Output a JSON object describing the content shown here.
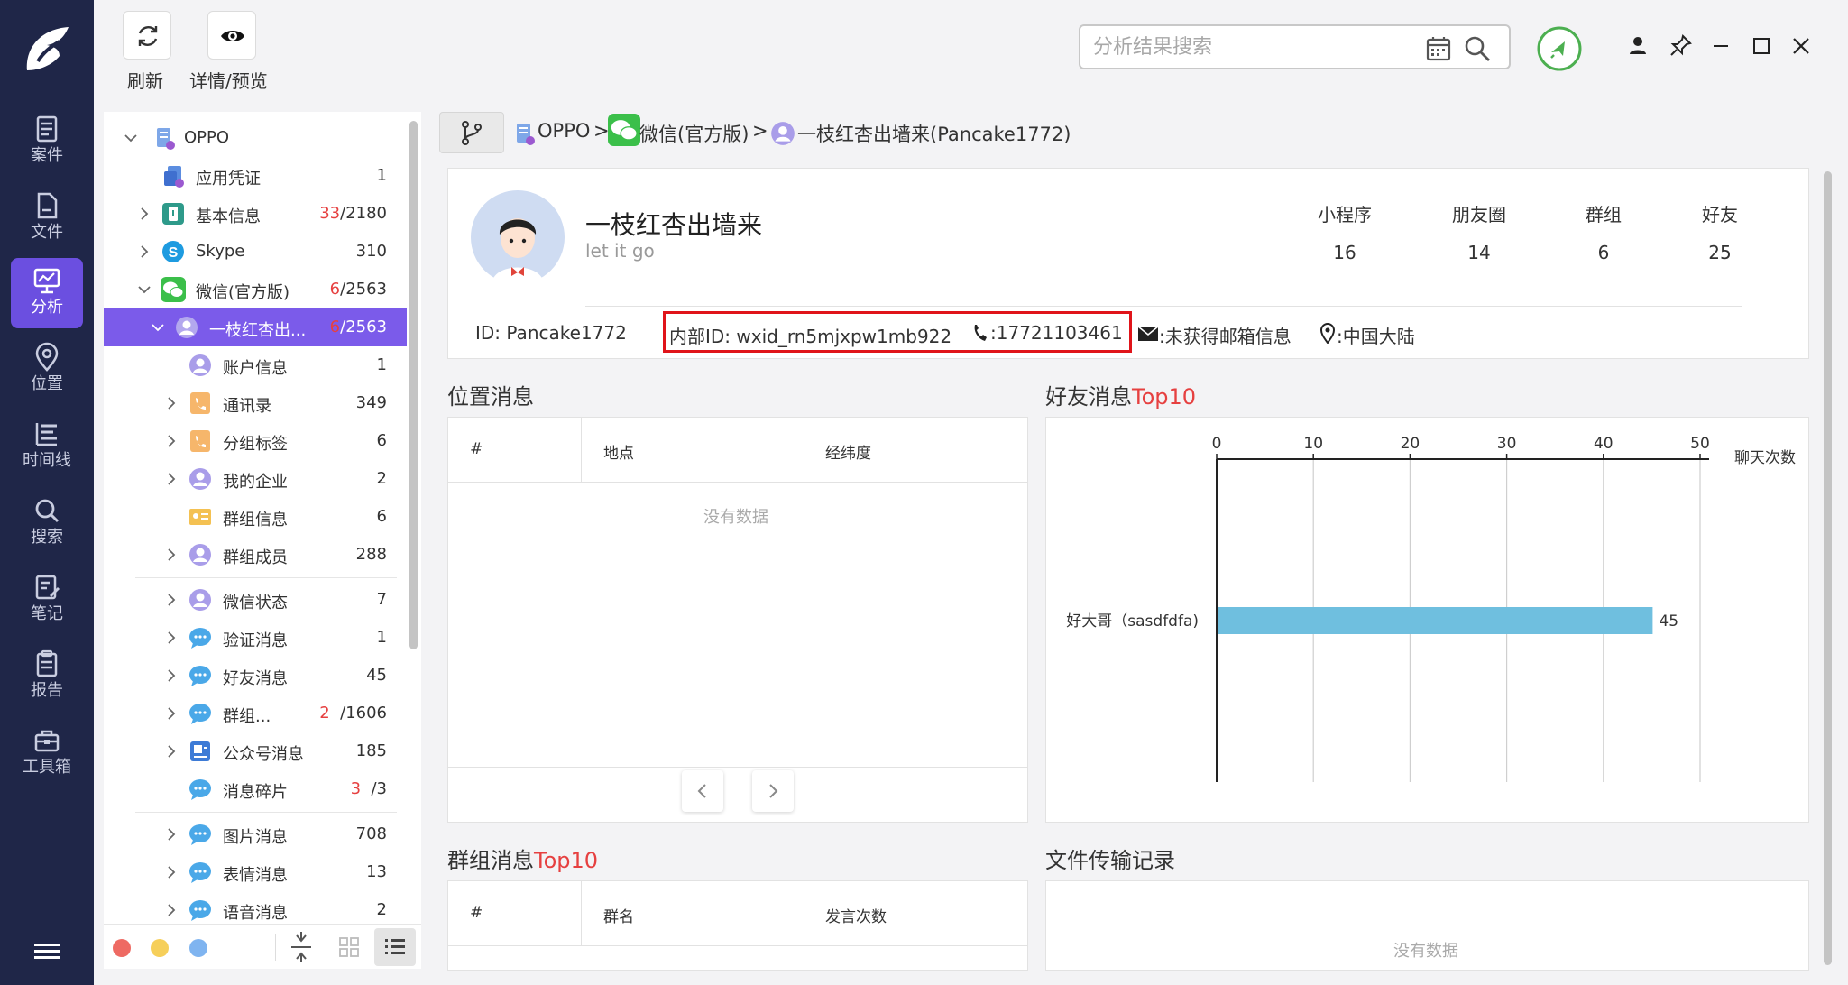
{
  "nav": {
    "items": [
      {
        "label": "案件",
        "icon": "case-icon"
      },
      {
        "label": "文件",
        "icon": "file-icon"
      },
      {
        "label": "分析",
        "icon": "analysis-icon"
      },
      {
        "label": "位置",
        "icon": "location-icon"
      },
      {
        "label": "时间线",
        "icon": "timeline-icon"
      },
      {
        "label": "搜索",
        "icon": "search-icon"
      },
      {
        "label": "笔记",
        "icon": "note-icon"
      },
      {
        "label": "报告",
        "icon": "report-icon"
      },
      {
        "label": "工具箱",
        "icon": "toolbox-icon"
      }
    ],
    "active_index": 2
  },
  "toolbar": {
    "refresh_label": "刷新",
    "preview_label": "详情/预览",
    "search_placeholder": "分析结果搜索"
  },
  "tree": {
    "rows": [
      {
        "label": "OPPO",
        "count": "",
        "count_red": ""
      },
      {
        "label": "应用凭证",
        "count": "1",
        "count_red": ""
      },
      {
        "label": "基本信息",
        "count": "/2180",
        "count_red": "33"
      },
      {
        "label": "Skype",
        "count": "310",
        "count_red": ""
      },
      {
        "label": "微信(官方版)",
        "count": "/2563",
        "count_red": "6"
      },
      {
        "label": "一枝红杏出...",
        "count": "/2563",
        "count_red": "6"
      },
      {
        "label": "账户信息",
        "count": "1",
        "count_red": ""
      },
      {
        "label": "通讯录",
        "count": "349",
        "count_red": ""
      },
      {
        "label": "分组标签",
        "count": "6",
        "count_red": ""
      },
      {
        "label": "我的企业",
        "count": "2",
        "count_red": ""
      },
      {
        "label": "群组信息",
        "count": "6",
        "count_red": ""
      },
      {
        "label": "群组成员",
        "count": "288",
        "count_red": ""
      },
      {
        "label": "微信状态",
        "count": "7",
        "count_red": ""
      },
      {
        "label": "验证消息",
        "count": "1",
        "count_red": ""
      },
      {
        "label": "好友消息",
        "count": "45",
        "count_red": ""
      },
      {
        "label": "群组...",
        "count": "/1606",
        "count_red": "2"
      },
      {
        "label": "公众号消息",
        "count": "185",
        "count_red": ""
      },
      {
        "label": "消息碎片",
        "count": "/3",
        "count_red": "3"
      },
      {
        "label": "图片消息",
        "count": "708",
        "count_red": ""
      },
      {
        "label": "表情消息",
        "count": "13",
        "count_red": ""
      },
      {
        "label": "语音消息",
        "count": "2",
        "count_red": ""
      }
    ]
  },
  "breadcrumb": {
    "items": [
      "OPPO",
      "微信(官方版)",
      "一枝红杏出墙来(Pancake1772)"
    ],
    "separator": ">"
  },
  "profile": {
    "name": "一枝红杏出墙来",
    "signature": "let it go",
    "stats": [
      {
        "label": "小程序",
        "value": "16"
      },
      {
        "label": "朋友圈",
        "value": "14"
      },
      {
        "label": "群组",
        "value": "6"
      },
      {
        "label": "好友",
        "value": "25"
      }
    ],
    "id": "ID: Pancake1772",
    "internal_id": "内部ID: wxid_rn5mjxpw1mb922",
    "phone": ":17721103461",
    "email": ":未获得邮箱信息",
    "region": ":中国大陆"
  },
  "location_section": {
    "title": "位置消息",
    "columns": [
      "#",
      "地点",
      "经纬度"
    ],
    "empty_text": "没有数据"
  },
  "friend_top10": {
    "title_main": "好友消息",
    "title_suffix": "Top10",
    "axis_label": "聊天次数",
    "value_label": "45"
  },
  "group_section": {
    "title_main": "群组消息",
    "title_suffix": "Top10",
    "columns": [
      "#",
      "群名",
      "发言次数"
    ]
  },
  "file_section": {
    "title": "文件传输记录",
    "empty_text": "没有数据"
  },
  "colors": {
    "nav_bg": "#1f2648",
    "accent": "#6b4fe0",
    "tree_selected": "#7b5bea",
    "bar": "#6fbfdf",
    "highlight_border": "#e0141a",
    "red_text": "#e64040"
  },
  "chart_data": {
    "type": "bar",
    "orientation": "horizontal",
    "categories": [
      "好大哥（sasdfdfa)"
    ],
    "values": [
      45
    ],
    "xlabel": "聊天次数",
    "xlim": [
      0,
      50
    ],
    "xticks": [
      0,
      10,
      20,
      30,
      40,
      50
    ],
    "grid": true
  }
}
